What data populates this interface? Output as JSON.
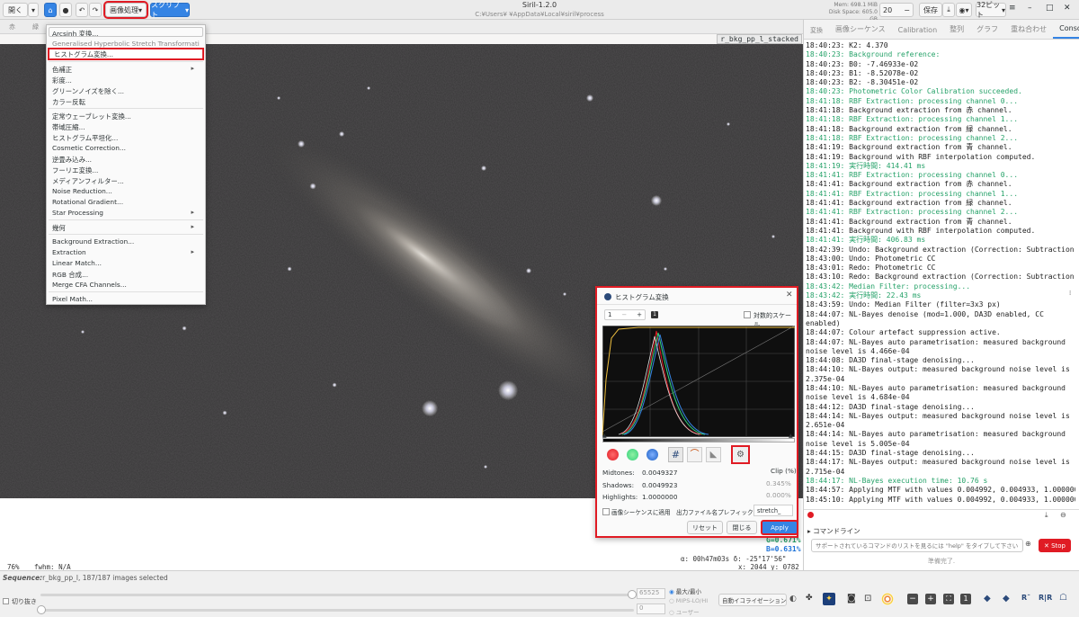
{
  "header": {
    "open_label": "開く",
    "image_processing_label": "画像処理",
    "scripts_label": "スクリプト",
    "title": "Siril-1.2.0",
    "path": "C:¥Users¥  ¥AppData¥Local¥siril¥process",
    "mem": "Mem: 698.1 MiB",
    "disk": "Disk Space: 605.0 GB",
    "thread_value": "20",
    "save_label": "保存",
    "bit_label": "32ビット"
  },
  "image": {
    "title": "r_bkg_pp_l_stacked"
  },
  "menu": {
    "items": [
      {
        "label": "Arcsinh 変換..."
      },
      {
        "label": "Generalised Hyperbolic Stretch Transformations..."
      },
      {
        "label": "ヒストグラム変換..."
      },
      {
        "label": "色補正"
      },
      {
        "label": "彩度..."
      },
      {
        "label": "グリーンノイズを除く..."
      },
      {
        "label": "カラー反転"
      },
      {
        "label": "定常ウェーブレット変換..."
      },
      {
        "label": "帯域圧縮..."
      },
      {
        "label": "ヒストグラム平坦化..."
      },
      {
        "label": "Cosmetic Correction..."
      },
      {
        "label": "逆畳み込み..."
      },
      {
        "label": "フーリエ変換..."
      },
      {
        "label": "メディアンフィルター..."
      },
      {
        "label": "Noise Reduction..."
      },
      {
        "label": "Rotational Gradient..."
      },
      {
        "label": "Star Processing"
      },
      {
        "label": "幾何"
      },
      {
        "label": "Background Extraction..."
      },
      {
        "label": "Extraction"
      },
      {
        "label": "Linear Match..."
      },
      {
        "label": "RGB 合成..."
      },
      {
        "label": "Merge CFA Channels..."
      },
      {
        "label": "Pixel Math..."
      }
    ]
  },
  "dialog": {
    "title": "ヒストグラム変換",
    "zoom_value": "1",
    "log_scale_label": "対数的スケール",
    "midtones_label": "Midtones:",
    "midtones_value": "0.0049327",
    "shadows_label": "Shadows:",
    "shadows_value": "0.0049923",
    "highlights_label": "Highlights:",
    "highlights_value": "1.0000000",
    "clip_label": "Clip (%)",
    "clip_shadows": "0.345%",
    "clip_highlights": "0.000%",
    "sequence_label": "画像シーケンスに適用",
    "prefix_label": "出力ファイル名プレフィックス:",
    "prefix_value": "stretch_",
    "reset_label": "リセット",
    "close_label": "閉じる",
    "apply_label": "Apply"
  },
  "right_panel": {
    "tabs": [
      "変換",
      "画像シーケンス",
      "Calibration",
      "整列",
      "グラフ",
      "重ね合わせ",
      "Console"
    ],
    "console_lines": [
      {
        "t": "18:40:23: K2: 4.370",
        "c": "n"
      },
      {
        "t": "18:40:23: Background reference:",
        "c": "g"
      },
      {
        "t": "18:40:23: B0: -7.46933e-02",
        "c": "n"
      },
      {
        "t": "18:40:23: B1: -8.52078e-02",
        "c": "n"
      },
      {
        "t": "18:40:23: B2: -8.30451e-02",
        "c": "n"
      },
      {
        "t": "18:40:23: Photometric Color Calibration succeeded.",
        "c": "g"
      },
      {
        "t": "18:41:18: RBF Extraction: processing channel 0...",
        "c": "g"
      },
      {
        "t": "18:41:18: Background extraction from 赤 channel.",
        "c": "n"
      },
      {
        "t": "18:41:18: RBF Extraction: processing channel 1...",
        "c": "g"
      },
      {
        "t": "18:41:18: Background extraction from 緑 channel.",
        "c": "n"
      },
      {
        "t": "18:41:18: RBF Extraction: processing channel 2...",
        "c": "g"
      },
      {
        "t": "18:41:19: Background extraction from 青 channel.",
        "c": "n"
      },
      {
        "t": "18:41:19: Background with RBF interpolation computed.",
        "c": "n"
      },
      {
        "t": "18:41:19: 実行時間: 414.41 ms",
        "c": "g"
      },
      {
        "t": "18:41:41: RBF Extraction: processing channel 0...",
        "c": "g"
      },
      {
        "t": "18:41:41: Background extraction from 赤 channel.",
        "c": "n"
      },
      {
        "t": "18:41:41: RBF Extraction: processing channel 1...",
        "c": "g"
      },
      {
        "t": "18:41:41: Background extraction from 緑 channel.",
        "c": "n"
      },
      {
        "t": "18:41:41: RBF Extraction: processing channel 2...",
        "c": "g"
      },
      {
        "t": "18:41:41: Background extraction from 青 channel.",
        "c": "n"
      },
      {
        "t": "18:41:41: Background with RBF interpolation computed.",
        "c": "n"
      },
      {
        "t": "18:41:41: 実行時間: 406.83 ms",
        "c": "g"
      },
      {
        "t": "18:42:39: Undo: Background extraction (Correction: Subtraction)",
        "c": "n"
      },
      {
        "t": "18:43:00: Undo: Photometric CC",
        "c": "n"
      },
      {
        "t": "18:43:01: Redo: Photometric CC",
        "c": "n"
      },
      {
        "t": "18:43:10: Redo: Background extraction (Correction: Subtraction)",
        "c": "n"
      },
      {
        "t": "18:43:42: Median Filter: processing...",
        "c": "g"
      },
      {
        "t": "18:43:42: 実行時間: 22.43 ms",
        "c": "g"
      },
      {
        "t": "18:43:59: Undo: Median Filter (filter=3x3 px)",
        "c": "n"
      },
      {
        "t": "18:44:07: NL-Bayes denoise (mod=1.000, DA3D enabled, CC",
        "c": "n"
      },
      {
        "t": "enabled)",
        "c": "n"
      },
      {
        "t": "18:44:07: Colour artefact suppression active.",
        "c": "n"
      },
      {
        "t": "18:44:07: NL-Bayes auto parametrisation: measured background",
        "c": "n"
      },
      {
        "t": "noise level is 4.466e-04",
        "c": "n"
      },
      {
        "t": "18:44:08: DA3D final-stage denoising...",
        "c": "n"
      },
      {
        "t": "18:44:10: NL-Bayes output: measured background noise level is",
        "c": "n"
      },
      {
        "t": "2.375e-04",
        "c": "n"
      },
      {
        "t": "18:44:10: NL-Bayes auto parametrisation: measured background",
        "c": "n"
      },
      {
        "t": "noise level is 4.684e-04",
        "c": "n"
      },
      {
        "t": "18:44:12: DA3D final-stage denoising...",
        "c": "n"
      },
      {
        "t": "18:44:14: NL-Bayes output: measured background noise level is",
        "c": "n"
      },
      {
        "t": "2.651e-04",
        "c": "n"
      },
      {
        "t": "18:44:14: NL-Bayes auto parametrisation: measured background",
        "c": "n"
      },
      {
        "t": "noise level is 5.005e-04",
        "c": "n"
      },
      {
        "t": "18:44:15: DA3D final-stage denoising...",
        "c": "n"
      },
      {
        "t": "18:44:17: NL-Bayes output: measured background noise level is",
        "c": "n"
      },
      {
        "t": "2.715e-04",
        "c": "n"
      },
      {
        "t": "18:44:17: NL-Bayes execution time: 10.76 s",
        "c": "g"
      },
      {
        "t": "18:44:57: Applying MTF with values 0.004992, 0.004933, 1.000000",
        "c": "n"
      },
      {
        "t": "18:45:10: Applying MTF with values 0.004992, 0.004933, 1.000000",
        "c": "n"
      }
    ],
    "command_label": "コマンドライン",
    "command_placeholder": "サポートされているコマンドのリストを見るには \"help\" をタイプして下さい",
    "stop_label": "Stop",
    "ready_label": "準備完了."
  },
  "info": {
    "zoom": "76%",
    "fwhm": "fwhm: N/A",
    "g_value": "G=0.671%",
    "b_value": "B=0.631%",
    "coords": "α: 00h47m03s δ: -25°17'56\"",
    "xy": "x: 2044 y: 0782"
  },
  "status": {
    "sequence_label": "Sequence:",
    "sequence_value": "r_bkg_pp_l, 187/187 images selected",
    "crop_label": "切り抜き",
    "hi_value": "65525",
    "lo_value": "0",
    "radio1": "最大/最小",
    "radio2": "MIPS-LO/HI",
    "radio3": "ユーザー",
    "display_mode": "自動イコライゼーション"
  },
  "colors": {
    "accent": "#3584e4",
    "highlight_red": "#e01b24",
    "console_green": "#26a269"
  }
}
